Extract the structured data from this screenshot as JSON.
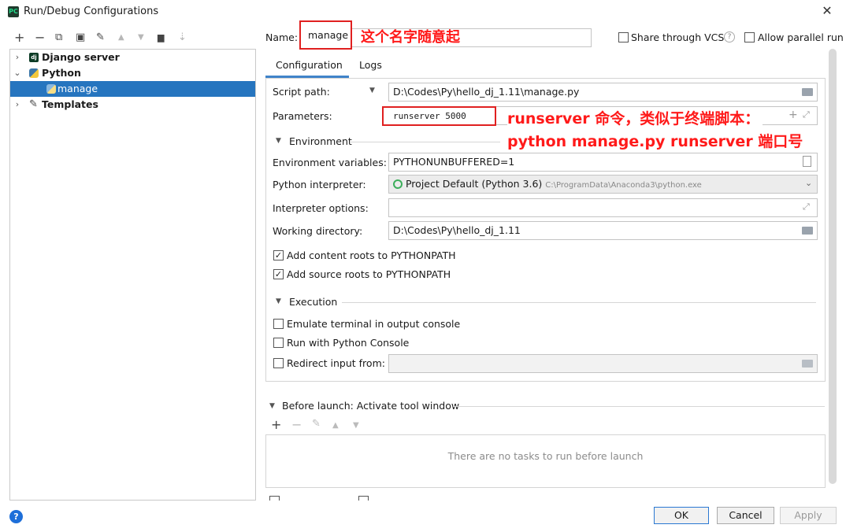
{
  "window": {
    "title": "Run/Debug Configurations",
    "app_logo": "PC"
  },
  "tree": {
    "items": [
      {
        "label": "Django server",
        "icon": "django-icon",
        "expanded": false
      },
      {
        "label": "Python",
        "icon": "python-icon",
        "expanded": true
      },
      {
        "label": "manage",
        "icon": "python-file-icon",
        "selected": true
      },
      {
        "label": "Templates",
        "icon": "wrench-icon",
        "expanded": false
      }
    ]
  },
  "toolbar": {
    "add": "+",
    "remove": "−",
    "copy": "⧉",
    "save": "▣",
    "wrench": "✎",
    "up": "▲",
    "down": "▼",
    "folder": "▆",
    "sort": "⇣"
  },
  "name_row": {
    "label": "Name:",
    "value": "manage",
    "share_label": "Share through VCS",
    "help": "?",
    "parallel_label": "Allow parallel run"
  },
  "tabs": [
    "Configuration",
    "Logs"
  ],
  "config": {
    "script_label": "Script path:",
    "script_value": "D:\\Codes\\Py\\hello_dj_1.11\\manage.py",
    "params_label": "Parameters:",
    "params_value": "runserver 5000",
    "env_section": "Environment",
    "env_label": "Environment variables:",
    "env_value": "PYTHONUNBUFFERED=1",
    "interp_label": "Python interpreter:",
    "interp_value": "Project Default (Python 3.6)",
    "interp_path": "C:\\ProgramData\\Anaconda3\\python.exe",
    "interp_opts_label": "Interpreter options:",
    "interp_opts_value": "",
    "workdir_label": "Working directory:",
    "workdir_value": "D:\\Codes\\Py\\hello_dj_1.11",
    "content_roots_label": "Add content roots to PYTHONPATH",
    "source_roots_label": "Add source roots to PYTHONPATH",
    "exec_section": "Execution",
    "emulate_label": "Emulate terminal in output console",
    "console_label": "Run with Python Console",
    "redirect_label": "Redirect input from:",
    "redirect_value": ""
  },
  "before_launch": {
    "title": "Before launch: Activate tool window",
    "empty_text": "There are no tasks to run before launch"
  },
  "annotations": {
    "name_note": "这个名字随意起",
    "params_note_1": "runserver 命令，类似于终端脚本：",
    "params_note_2": "python manage.py runserver 端口号"
  },
  "buttons": {
    "ok": "OK",
    "cancel": "Cancel",
    "apply": "Apply"
  },
  "colors": {
    "selection": "#2675bf",
    "annotation": "#ff1a1a",
    "help": "#1e6fd9"
  }
}
